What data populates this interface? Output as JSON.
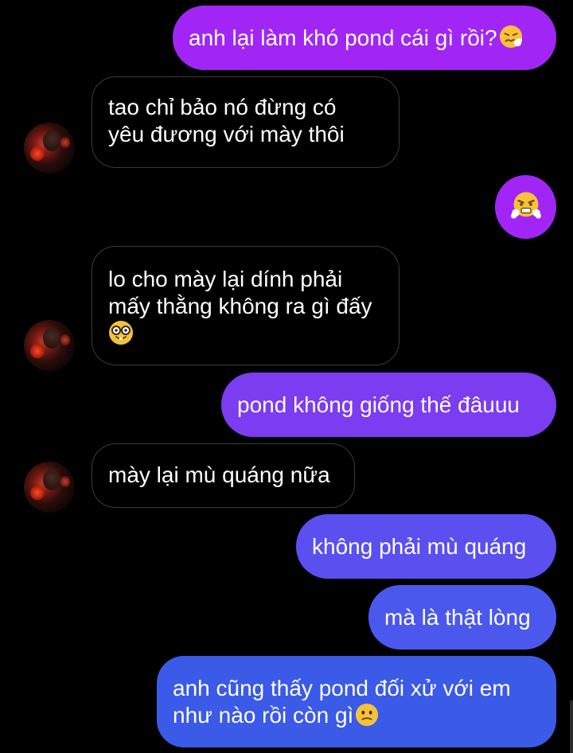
{
  "colors": {
    "outgoing_purple": "#a126f5",
    "outgoing_violet": "#7c3cf0",
    "outgoing_indigo": "#5b4ff0",
    "outgoing_blue": "#3b5ae8",
    "incoming_border": "#3a3a3a",
    "background": "#000000"
  },
  "messages": [
    {
      "id": "m1",
      "direction": "outgoing",
      "lines": [
        "anh lại làm khó pond cái gì rồi?"
      ],
      "emoji": "persevering-face-icon"
    },
    {
      "id": "m2",
      "direction": "incoming",
      "lines": [
        "tao chỉ bảo nó đừng có",
        "yêu đương với mày thôi"
      ]
    },
    {
      "id": "m3",
      "direction": "outgoing",
      "lines": [],
      "emoji": "face-with-steam-icon"
    },
    {
      "id": "m4",
      "direction": "incoming",
      "lines": [
        "lo cho mày lại dính phải",
        "mấy thằng không ra gì đấy"
      ],
      "emoji": "nerd-face-icon"
    },
    {
      "id": "m5",
      "direction": "outgoing",
      "lines": [
        "pond không giống thế đâuuu"
      ]
    },
    {
      "id": "m6",
      "direction": "incoming",
      "lines": [
        "mày lại mù quáng nữa"
      ]
    },
    {
      "id": "m7",
      "direction": "outgoing",
      "lines": [
        "không phải mù quáng"
      ]
    },
    {
      "id": "m8",
      "direction": "outgoing",
      "lines": [
        "mà là thật lòng"
      ]
    },
    {
      "id": "m9",
      "direction": "outgoing",
      "lines": [
        "anh cũng thấy pond đối xử với em",
        "như nào rồi còn gì"
      ],
      "emoji": "confused-face-icon"
    }
  ]
}
